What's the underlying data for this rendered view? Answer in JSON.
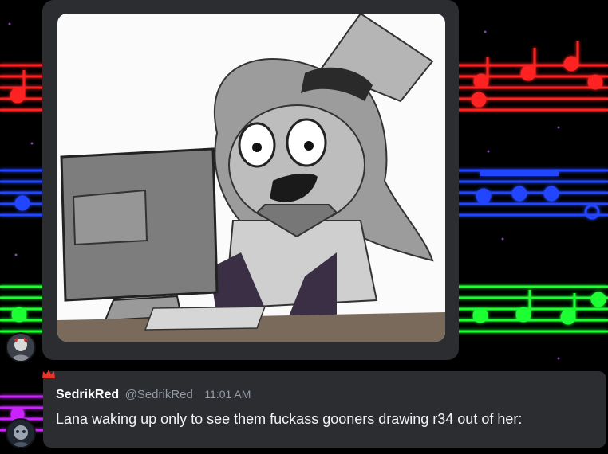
{
  "post": {
    "image": {
      "subject": "cartoon girl at computer",
      "icon": "artwork-image"
    }
  },
  "message": {
    "author": "SedrikRed",
    "handle": "@SedrikRed",
    "timestamp": "11:01 AM",
    "text": "Lana waking up only to see them fuckass gooners drawing r34 out of her:",
    "badge_icon": "crown-icon"
  },
  "colors": {
    "card_bg": "#2b2d31",
    "staff_red": "#ff1a1a",
    "staff_blue": "#1a4dff",
    "staff_green": "#1aff3a",
    "muted_text": "#949ba4",
    "crown": "#e8342a"
  }
}
